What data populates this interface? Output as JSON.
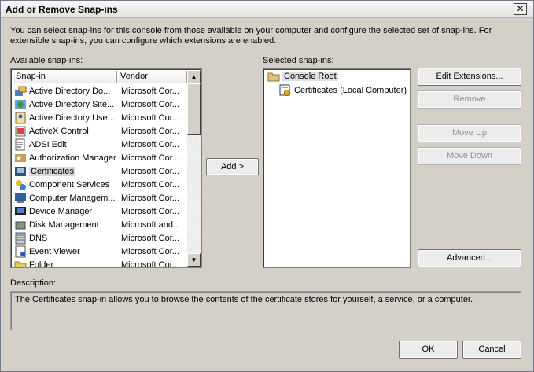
{
  "window": {
    "title": "Add or Remove Snap-ins"
  },
  "intro": "You can select snap-ins for this console from those available on your computer and configure the selected set of snap-ins. For extensible snap-ins, you can configure which extensions are enabled.",
  "available": {
    "label": "Available snap-ins:",
    "columns": [
      "Snap-in",
      "Vendor"
    ],
    "rows": [
      {
        "name": "Active Directory Do...",
        "vendor": "Microsoft Cor...",
        "icon": "ad-domains-icon"
      },
      {
        "name": "Active Directory Site...",
        "vendor": "Microsoft Cor...",
        "icon": "ad-sites-icon"
      },
      {
        "name": "Active Directory Use...",
        "vendor": "Microsoft Cor...",
        "icon": "ad-users-icon"
      },
      {
        "name": "ActiveX Control",
        "vendor": "Microsoft Cor...",
        "icon": "activex-icon"
      },
      {
        "name": "ADSI Edit",
        "vendor": "Microsoft Cor...",
        "icon": "adsi-edit-icon"
      },
      {
        "name": "Authorization Manager",
        "vendor": "Microsoft Cor...",
        "icon": "authorization-icon"
      },
      {
        "name": "Certificates",
        "vendor": "Microsoft Cor...",
        "icon": "certificates-icon"
      },
      {
        "name": "Component Services",
        "vendor": "Microsoft Cor...",
        "icon": "component-services-icon"
      },
      {
        "name": "Computer Managem...",
        "vendor": "Microsoft Cor...",
        "icon": "computer-management-icon"
      },
      {
        "name": "Device Manager",
        "vendor": "Microsoft Cor...",
        "icon": "device-manager-icon"
      },
      {
        "name": "Disk Management",
        "vendor": "Microsoft and...",
        "icon": "disk-management-icon"
      },
      {
        "name": "DNS",
        "vendor": "Microsoft Cor...",
        "icon": "dns-icon"
      },
      {
        "name": "Event Viewer",
        "vendor": "Microsoft Cor...",
        "icon": "event-viewer-icon"
      },
      {
        "name": "Folder",
        "vendor": "Microsoft Cor...",
        "icon": "folder-icon"
      }
    ],
    "selected_index": 6
  },
  "add_button": "Add >",
  "selected": {
    "label": "Selected snap-ins:",
    "root": "Console Root",
    "child": "Certificates (Local Computer)"
  },
  "buttons": {
    "edit_extensions": "Edit Extensions...",
    "remove": "Remove",
    "move_up": "Move Up",
    "move_down": "Move Down",
    "advanced": "Advanced...",
    "ok": "OK",
    "cancel": "Cancel"
  },
  "description": {
    "label": "Description:",
    "text": "The Certificates snap-in allows you to browse the contents of the certificate stores for yourself, a service, or a computer."
  }
}
